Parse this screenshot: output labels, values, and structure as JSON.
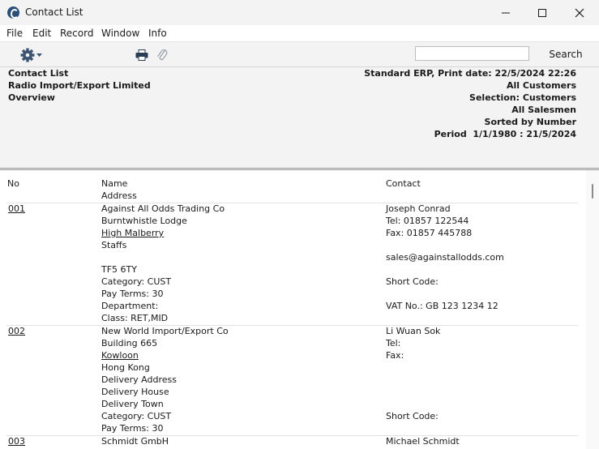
{
  "window": {
    "title": "Contact List"
  },
  "menu": [
    "File",
    "Edit",
    "Record",
    "Window",
    "Info"
  ],
  "toolbar": {
    "search_value": "",
    "search_label": "Search"
  },
  "header": {
    "left": [
      "Contact List",
      "Radio Import/Export Limited",
      "Overview"
    ],
    "right": [
      "Standard ERP, Print date: 22/5/2024 22:26",
      "All Customers",
      "Selection: Customers",
      "All Salesmen",
      "Sorted by Number",
      "Period  1/1/1980 : 21/5/2024"
    ]
  },
  "columns": {
    "no": "No",
    "name": "Name",
    "address": "Address",
    "contact": "Contact"
  },
  "rows": [
    {
      "no": "001",
      "name": "Against All Odds Trading Co",
      "address": [
        "Burntwhistle Lodge",
        "High Malberry",
        "Staffs",
        "",
        "TF5 6TY"
      ],
      "category": "Category: CUST",
      "pay_terms": "Pay Terms: 30",
      "department": "Department:",
      "class": "Class: RET,MID",
      "contact": "Joseph Conrad",
      "tel": "Tel: 01857 122544",
      "fax": "Fax: 01857 445788",
      "email": "sales@againstallodds.com",
      "short_code": "Short Code:",
      "vat": "VAT No.: GB 123 1234 12"
    },
    {
      "no": "002",
      "name": "New World Import/Export Co",
      "address": [
        "Building 665",
        "Kowloon",
        "Hong Kong",
        "Delivery Address",
        "Delivery House",
        "Delivery Town"
      ],
      "category": "Category: CUST",
      "pay_terms": "Pay Terms: 30",
      "contact": "Li Wuan Sok",
      "tel": "Tel:",
      "fax": "Fax:",
      "short_code": "Short Code:"
    },
    {
      "no": "003",
      "name": "Schmidt GmbH",
      "contact": "Michael Schmidt"
    }
  ]
}
